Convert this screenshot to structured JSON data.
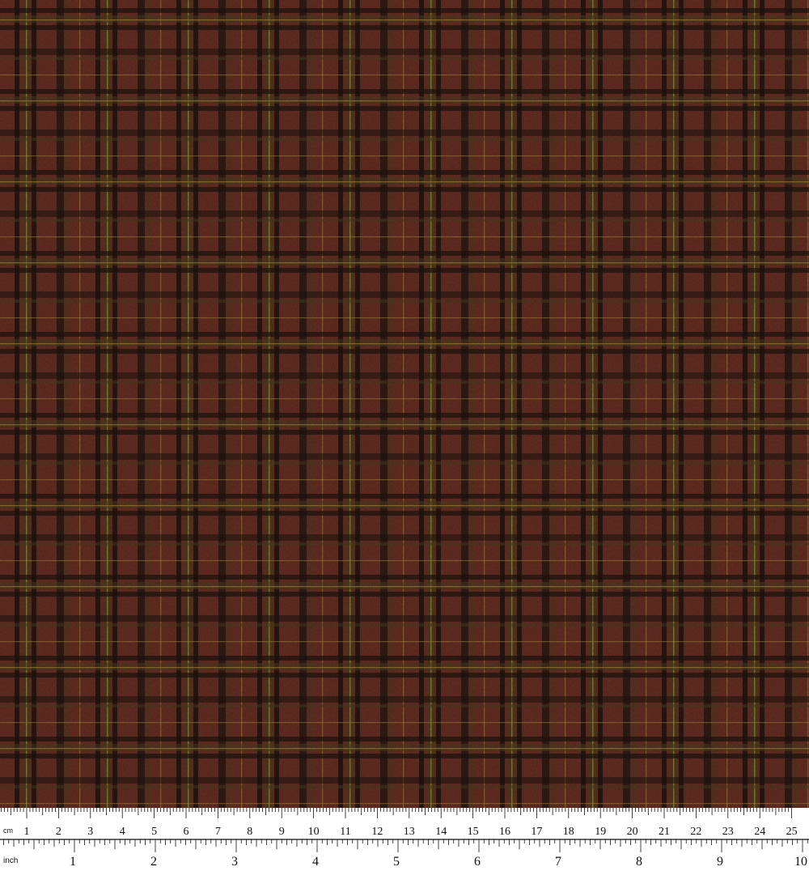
{
  "image": {
    "subject": "plaid-fabric-swatch",
    "colors": {
      "ground": "#6a2f24",
      "ground_light": "#7b3a2c",
      "dark_stripe": "#1e1410",
      "olive_stripe": "#4c4020",
      "gold_thread": "#b89a48",
      "ruler_bg": "#ffffff",
      "ruler_ink": "#111111"
    }
  },
  "ruler": {
    "cm_unit_label": "cm",
    "inch_unit_label": "inch",
    "cm_labels": [
      "1",
      "2",
      "3",
      "4",
      "5",
      "6",
      "7",
      "8",
      "9",
      "10",
      "11",
      "12",
      "13",
      "14",
      "15",
      "16",
      "17",
      "18",
      "19",
      "20",
      "21",
      "22",
      "23",
      "24",
      "25"
    ],
    "inch_labels": [
      "1",
      "2",
      "3",
      "4",
      "5",
      "6",
      "7",
      "8",
      "9",
      "10"
    ]
  }
}
